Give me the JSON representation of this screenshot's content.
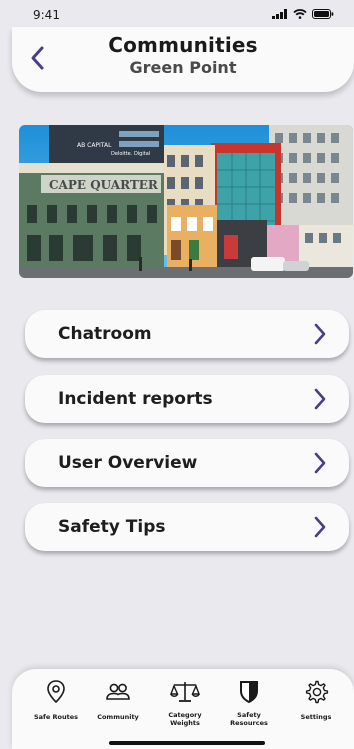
{
  "status_bar": {
    "time": "9:41"
  },
  "header": {
    "title": "Communities",
    "subtitle": "Green Point"
  },
  "hero": {
    "sign_text": "CAPE QUARTER",
    "building_text_1": "AB CAPITAL",
    "building_text_2": "Deloitte. Digital"
  },
  "menu": [
    {
      "label": "Chatroom"
    },
    {
      "label": "Incident reports"
    },
    {
      "label": "User Overview"
    },
    {
      "label": "Safety Tips"
    }
  ],
  "tabbar": {
    "tabs": [
      {
        "label": "Safe Routes",
        "icon": "map-pin-icon"
      },
      {
        "label": "Community",
        "icon": "people-icon"
      },
      {
        "label": "Category Weights",
        "line1": "Category",
        "line2": "Weights",
        "icon": "scales-icon"
      },
      {
        "label": "Safety Resources",
        "line1": "Safety",
        "line2": "Resources",
        "icon": "shield-icon"
      },
      {
        "label": "Settings",
        "icon": "gear-icon"
      }
    ]
  },
  "colors": {
    "accent": "#4a3f85",
    "background": "#e9e9ee",
    "card": "#fafafa"
  }
}
